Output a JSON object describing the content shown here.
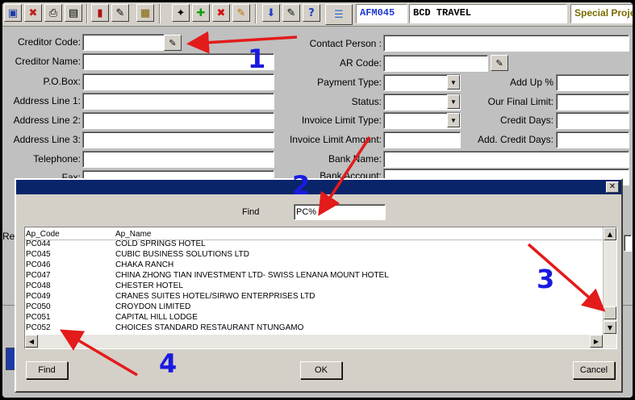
{
  "toolbar": {
    "module_code": "AFM045",
    "company": "BCD TRAVEL",
    "project": "Special Proje",
    "icons": [
      "save-icon",
      "delete-record-icon",
      "print-icon",
      "print-preview-icon",
      "exit-door-icon",
      "pen-icon",
      "calendar-icon",
      "wand-icon",
      "add-icon",
      "cancel-icon",
      "edit-pencil-icon",
      "download-icon",
      "notes-icon",
      "help-icon",
      "document-list-icon"
    ]
  },
  "form": {
    "left_labels": {
      "creditor_code": "Creditor  Code:",
      "creditor_name": "Creditor  Name:",
      "po_box": "P.O.Box:",
      "address1": "Address Line 1:",
      "address2": "Address Line 2:",
      "address3": "Address Line 3:",
      "telephone": "Telephone:",
      "fax": "Fax:",
      "re": "Re"
    },
    "mid_labels": {
      "contact_person": "Contact Person :",
      "ar_code": "AR Code:",
      "payment_type": "Payment Type:",
      "status": "Status:",
      "invoice_limit_type": "Invoice Limit Type:",
      "invoice_limit_amount": "Invoice Limit Amount:",
      "bank_name": "Bank Name:",
      "bank_account": "Bank Account:"
    },
    "right_labels": {
      "add_up": "Add Up %",
      "final_limit": "Our Final Limit:",
      "credit_days": "Credit Days:",
      "add_credit_days": "Add. Credit Days:"
    }
  },
  "dialog": {
    "find_label": "Find",
    "find_value": "PC%",
    "columns": [
      "Ap_Code",
      "Ap_Name"
    ],
    "rows": [
      [
        "PC044",
        "COLD SPRINGS HOTEL"
      ],
      [
        "PC045",
        "CUBIC BUSINESS SOLUTIONS LTD"
      ],
      [
        "PC046",
        "CHAKA RANCH"
      ],
      [
        "PC047",
        "CHINA ZHONG TIAN INVESTMENT LTD- SWISS LENANA MOUNT HOTEL"
      ],
      [
        "PC048",
        "CHESTER HOTEL"
      ],
      [
        "PC049",
        "CRANES SUITES HOTEL/SIRWO ENTERPRISES LTD"
      ],
      [
        "PC050",
        "CROYDON LIMITED"
      ],
      [
        "PC051",
        "CAPITAL HILL LODGE"
      ],
      [
        "PC052",
        "CHOICES STANDARD RESTAURANT NTUNGAMO"
      ]
    ],
    "buttons": {
      "find": "Find",
      "ok": "OK",
      "cancel": "Cancel"
    },
    "close_glyph": "✕"
  },
  "annotations": {
    "n1": "1",
    "n2": "2",
    "n3": "3",
    "n4": "4",
    "arrow_color": "#e31b1b"
  }
}
